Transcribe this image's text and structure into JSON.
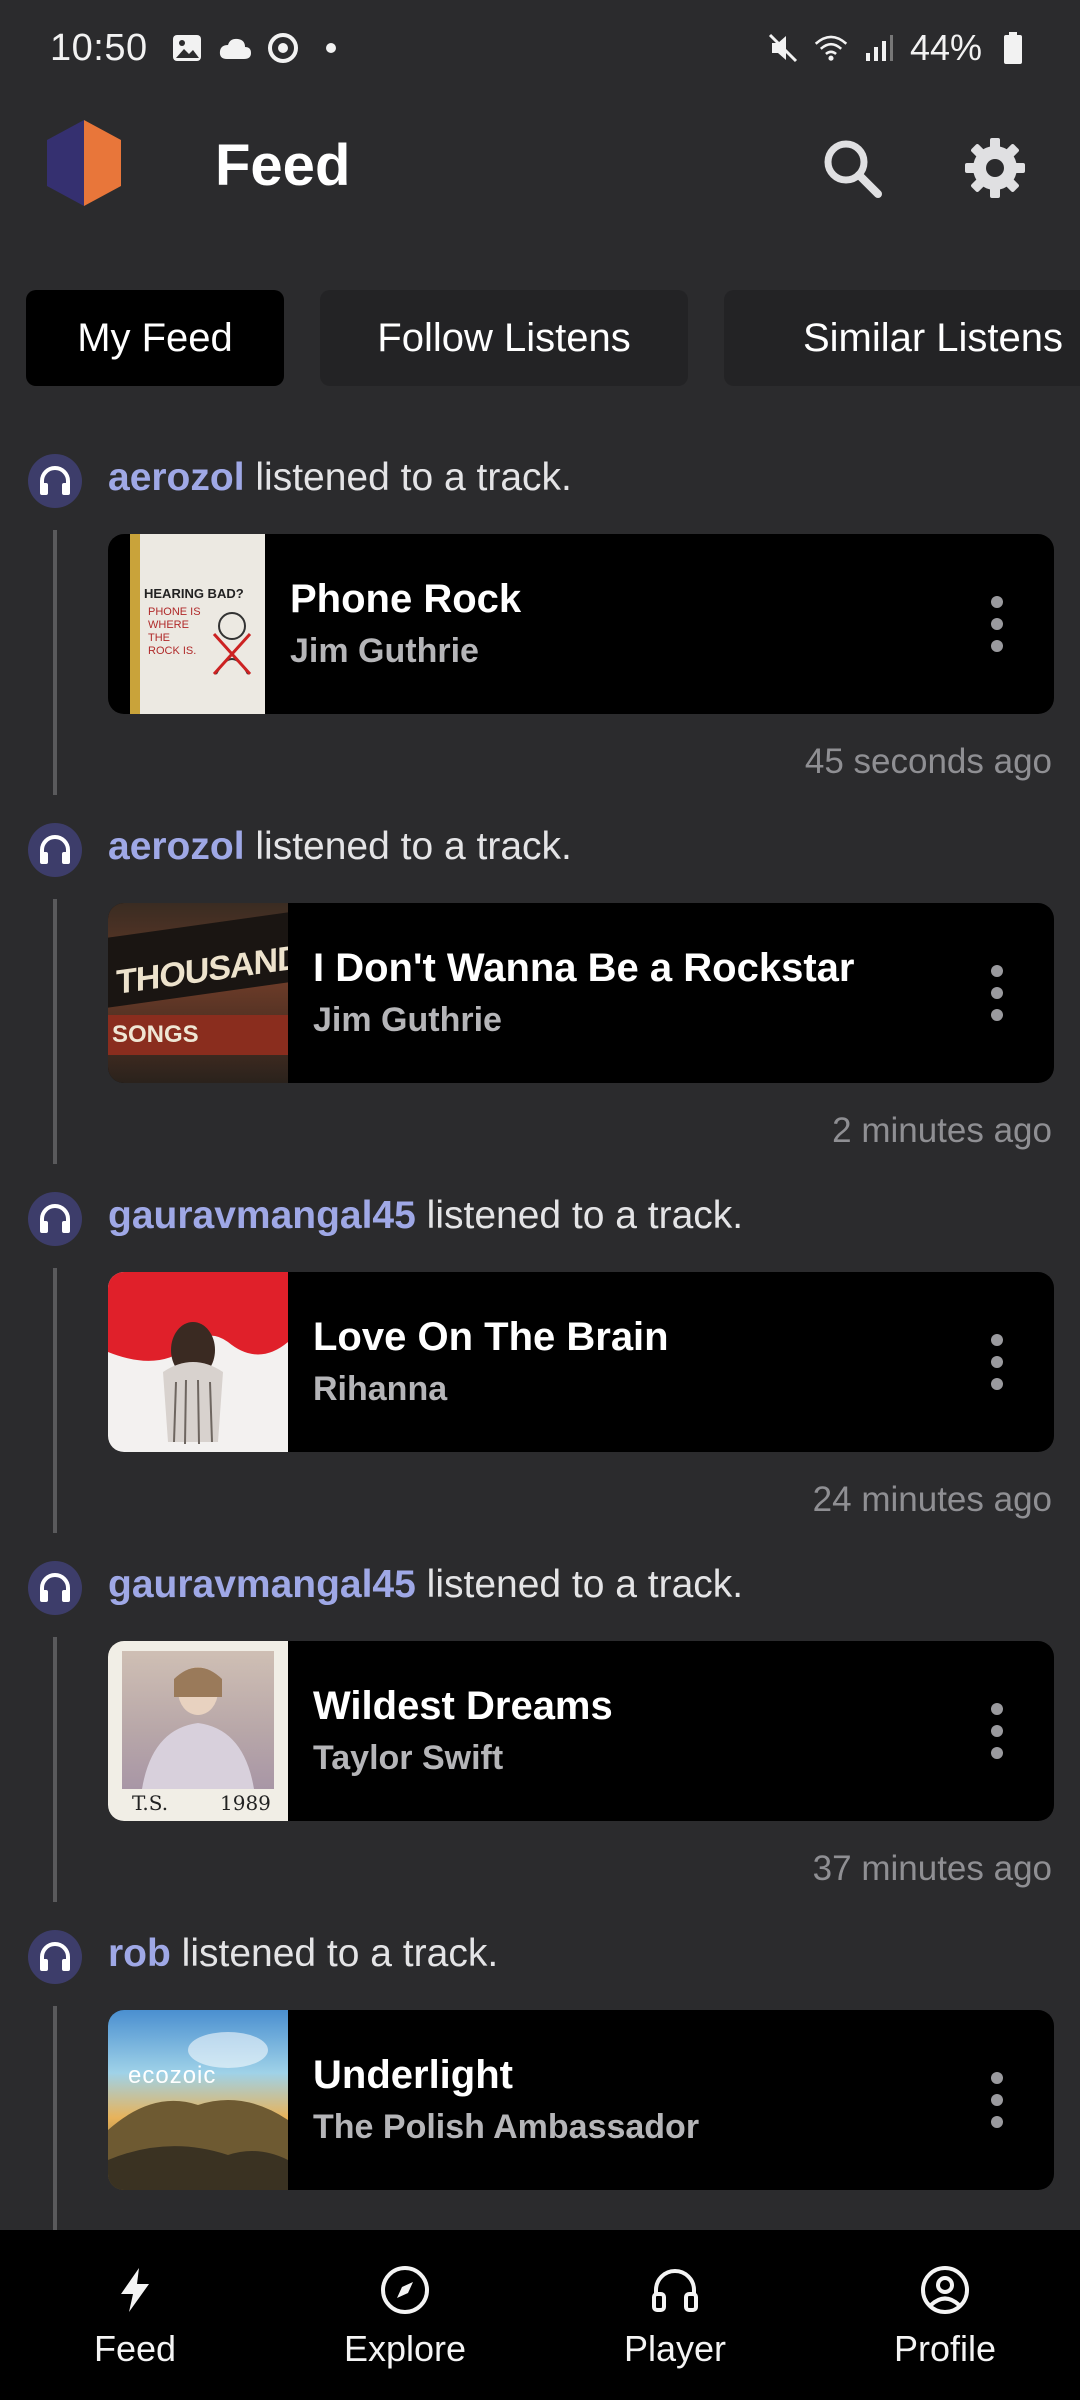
{
  "status_bar": {
    "time": "10:50",
    "battery": "44%",
    "icons": [
      "image-icon",
      "cloud-icon",
      "sync-icon",
      "dot-icon",
      "mute-icon",
      "wifi-icon",
      "signal-icon",
      "battery-icon"
    ]
  },
  "app_bar": {
    "title": "Feed",
    "logo_colors": [
      "#353070",
      "#e8763a"
    ]
  },
  "tabs": [
    {
      "label": "My Feed",
      "active": true
    },
    {
      "label": "Follow Listens",
      "active": false
    },
    {
      "label": "Similar Listens",
      "active": false
    }
  ],
  "feed": [
    {
      "user": "aerozol",
      "action": " listened to a track.",
      "title": "Phone Rock",
      "artist": "Jim Guthrie",
      "time": "45 seconds ago"
    },
    {
      "user": "aerozol",
      "action": " listened to a track.",
      "title": "I Don't Wanna Be a Rockstar",
      "artist": "Jim Guthrie",
      "time": "2 minutes ago"
    },
    {
      "user": "gauravmangal45",
      "action": " listened to a track.",
      "title": "Love On The Brain",
      "artist": "Rihanna",
      "time": "24 minutes ago"
    },
    {
      "user": "gauravmangal45",
      "action": " listened to a track.",
      "title": "Wildest Dreams",
      "artist": "Taylor Swift",
      "time": "37 minutes ago"
    },
    {
      "user": "rob",
      "action": " listened to a track.",
      "title": "Underlight",
      "artist": "The Polish Ambassador",
      "time": ""
    }
  ],
  "album_art_text": {
    "art0": {
      "line1": "HEARING BAD?",
      "line2": "PHONE IS WHERE THE ROCK IS."
    },
    "art1": {
      "line1": "THOUSAND",
      "line2": "SONGS"
    },
    "art3": {
      "line1": "T.S.",
      "line2": "1989"
    },
    "art4": {
      "line1": "ecozoic"
    }
  },
  "bottom_nav": [
    {
      "label": "Feed",
      "icon": "lightning-icon"
    },
    {
      "label": "Explore",
      "icon": "compass-icon"
    },
    {
      "label": "Player",
      "icon": "headphones-icon"
    },
    {
      "label": "Profile",
      "icon": "profile-icon"
    }
  ],
  "colors": {
    "background": "#2b2b2d",
    "username": "#9fa8e6",
    "card": "#000000",
    "active_tab": "#000000",
    "inactive_tab": "#232325"
  }
}
